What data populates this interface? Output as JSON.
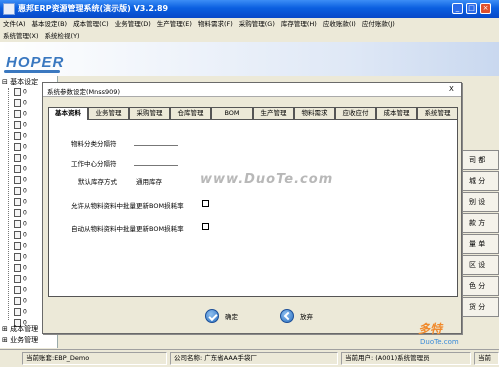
{
  "window": {
    "title": "惠邦ERP资源管理系统(演示版) V3.2.89"
  },
  "menu": {
    "row1": [
      "文件(A)",
      "基本设定(B)",
      "成本管理(C)",
      "业务管理(D)",
      "生产管理(E)",
      "物料需求(F)",
      "采购管理(G)",
      "库存管理(H)",
      "应收账款(I)",
      "应付账款(J)"
    ],
    "row2": [
      "系统管理(X)",
      "系统检视(Y)"
    ]
  },
  "banner": {
    "logo_text": "HOPER"
  },
  "tree": {
    "root_label": "基本设定",
    "item_prefixes": [
      "0",
      "0",
      "0",
      "0",
      "0",
      "0",
      "0",
      "0",
      "0",
      "0",
      "0",
      "0",
      "0",
      "0",
      "0",
      "0",
      "0",
      "0",
      "0",
      "0",
      "0",
      "0"
    ],
    "foot1": "成本管理",
    "foot2": "业务管理"
  },
  "right_strip": {
    "items": [
      "司 都",
      "城 分",
      "别 设",
      "款 方",
      "量 单",
      "区 设",
      "色 分",
      "货 分"
    ]
  },
  "dialog": {
    "title": "系统参数设定(Mnss909)",
    "close_label": "X",
    "tabs": [
      "基本资料",
      "业务管理",
      "采购管理",
      "仓库管理",
      "BOM",
      "生产管理",
      "物料需求",
      "应收应付",
      "成本管理",
      "系统管理"
    ],
    "active_tab": 0,
    "fields": {
      "material_separator_label": "物料分类分隔符",
      "material_separator_value": "",
      "workcenter_separator_label": "工作中心分隔符",
      "workcenter_separator_value": "",
      "inventory_mode_label": "默认库存方式",
      "inventory_mode_value": "通用库存",
      "allow_bom_update_label": "允许从物料资料中批量更新BOM损耗率",
      "auto_bom_update_label": "自动从物料资料中批量更新BOM损耗率"
    },
    "buttons": {
      "ok_label": "确定",
      "cancel_label": "放弃"
    }
  },
  "status": {
    "account": "当前账套:EBP_Demo",
    "company": "公司名称: 广东省AAA手袋厂",
    "user": "当前用户: (A001)系统管理员",
    "extra": "当前"
  },
  "watermark": {
    "site": "www.DuoTe.com",
    "brand": "多特",
    "brand_sub": "DuoTe.com"
  }
}
